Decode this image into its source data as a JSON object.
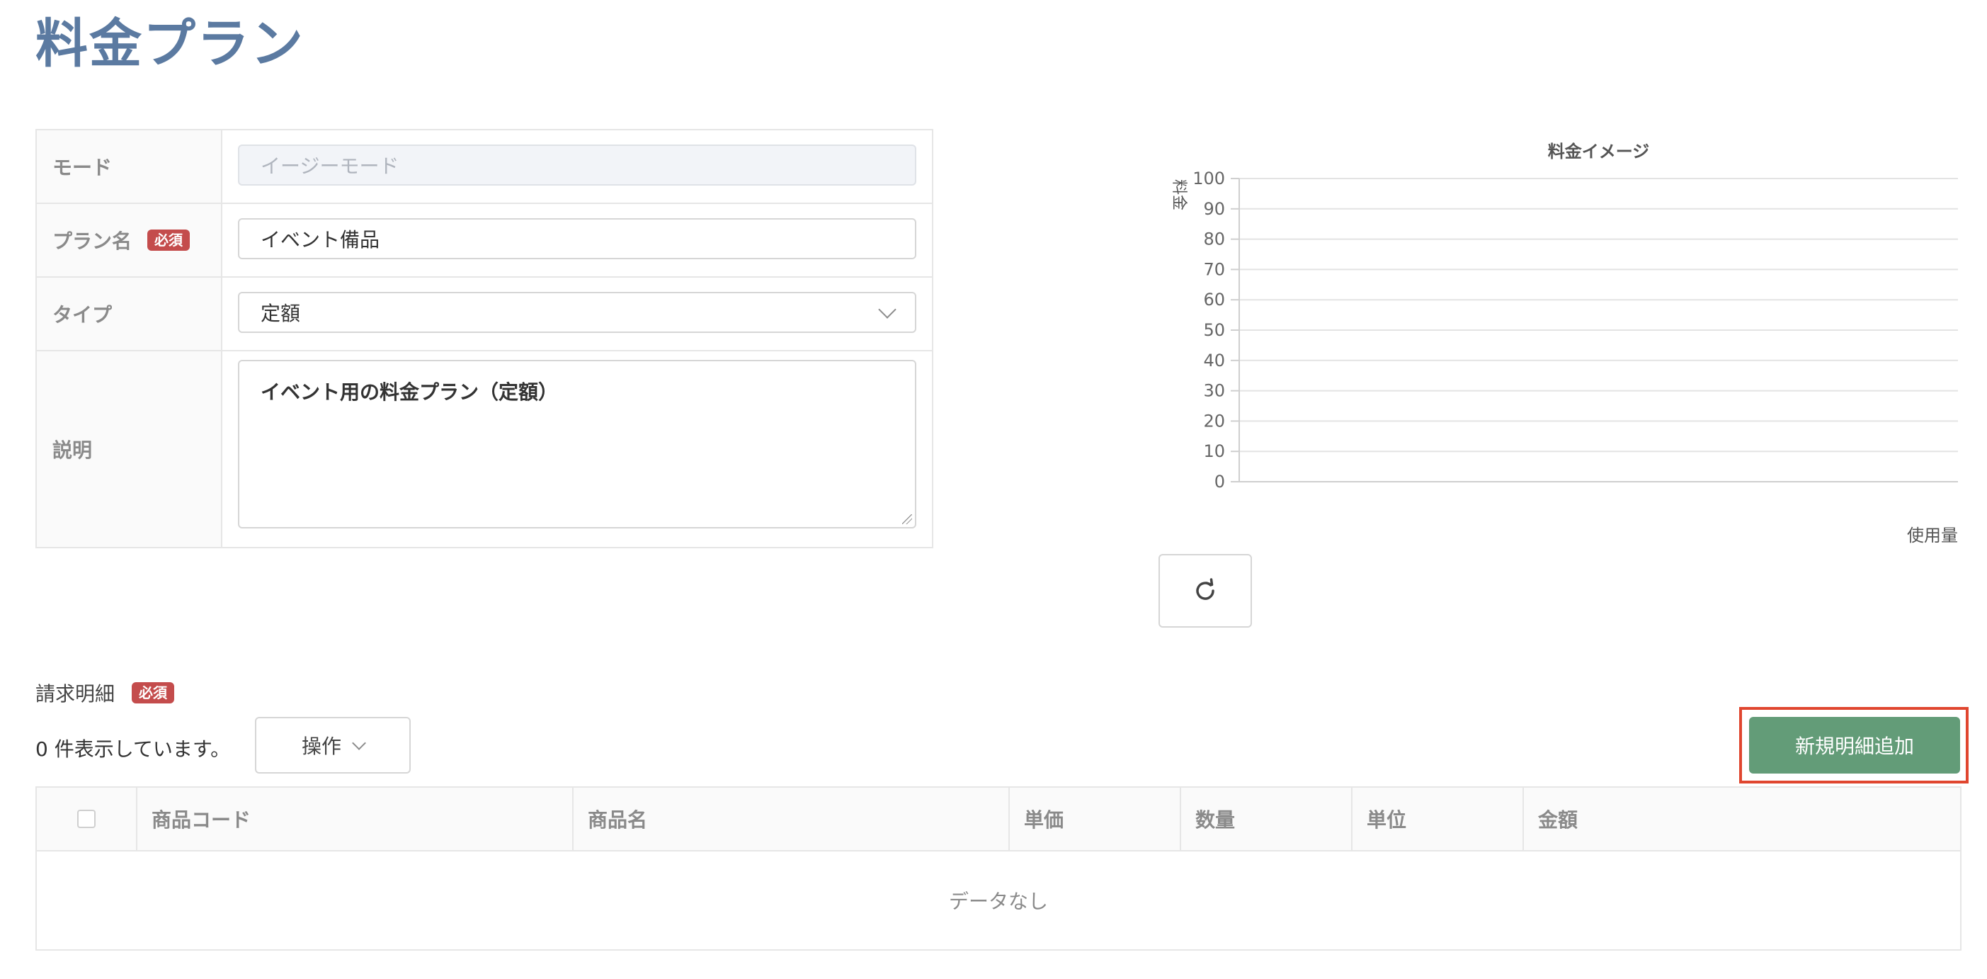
{
  "page": {
    "title": "料金プラン"
  },
  "form": {
    "mode": {
      "label": "モード",
      "placeholder": "イージーモード"
    },
    "plan_name": {
      "label": "プラン名",
      "badge": "必須",
      "value": "イベント備品"
    },
    "type": {
      "label": "タイプ",
      "value": "定額"
    },
    "description": {
      "label": "説明",
      "value": "イベント用の料金プラン（定額）"
    }
  },
  "chart_data": {
    "type": "line",
    "title": "料金イメージ",
    "ylabel": "料金",
    "xlabel": "使用量",
    "ylim": [
      0,
      100
    ],
    "yticks": [
      "100",
      "90",
      "80",
      "70",
      "60",
      "50",
      "40",
      "30",
      "20",
      "10",
      "0"
    ],
    "series": [],
    "grid": true
  },
  "details": {
    "label": "請求明細",
    "badge": "必須",
    "count_text": "0 件表示しています。",
    "ops_label": "操作",
    "add_label": "新規明細追加",
    "columns": [
      "商品コード",
      "商品名",
      "単価",
      "数量",
      "単位",
      "金額"
    ],
    "empty_text": "データなし"
  },
  "colors": {
    "title": "#5b7aa1",
    "badge": "#c44c4c",
    "add_button": "#639c78",
    "highlight": "#e0462f"
  }
}
